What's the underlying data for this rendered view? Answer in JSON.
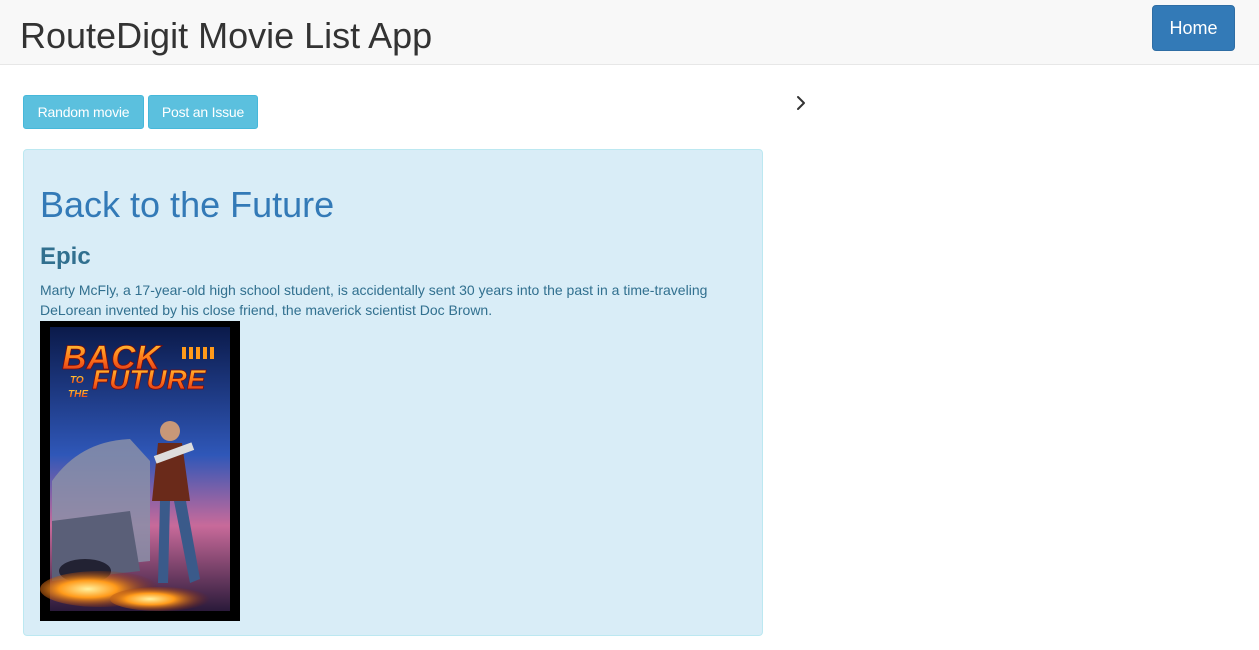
{
  "navbar": {
    "brand": "RouteDigit Movie List App",
    "home_label": "Home"
  },
  "actions": {
    "random_label": "Random movie",
    "issue_label": "Post an Issue",
    "next_icon": "chevron-right-icon"
  },
  "movie": {
    "title": "Back to the Future",
    "genre": "Epic",
    "description": "Marty McFly, a 17-year-old high school student, is accidentally sent 30 years into the past in a time-traveling DeLorean invented by his close friend, the maverick scientist Doc Brown.",
    "poster": {
      "line1": "BACK",
      "line2_small": "TO",
      "line2_small_b": "THE",
      "line2": "FUTURE"
    }
  },
  "colors": {
    "primary": "#337ab7",
    "info": "#5bc0de",
    "panel_bg": "#d9edf7",
    "panel_text": "#31708f"
  }
}
